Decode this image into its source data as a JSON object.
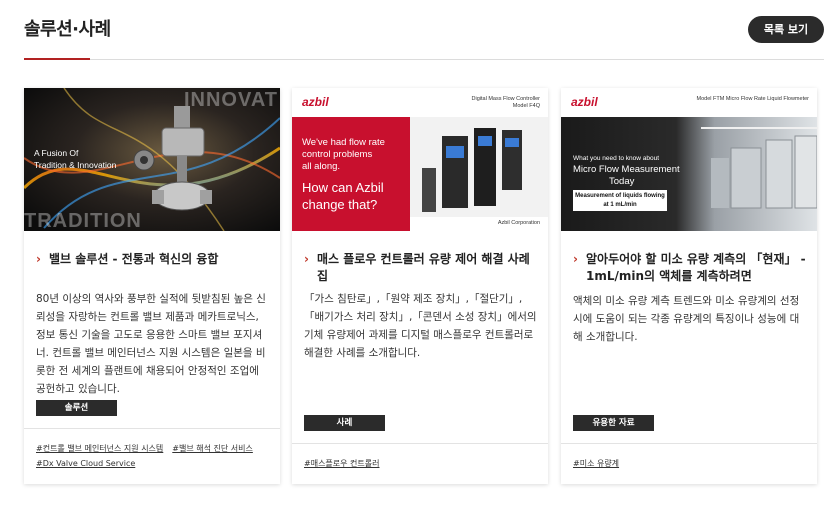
{
  "header": {
    "title": "솔루션·사례",
    "list_button": "목록 보기"
  },
  "cards": [
    {
      "image": {
        "overlay_line1": "A Fusion Of",
        "overlay_line2": "Tradition & Innovation",
        "word_top": "INNOVAT",
        "word_bottom": "TRADITION"
      },
      "title": "밸브 솔루션 - 전통과 혁신의 융합",
      "description": "80년 이상의 역사와 풍부한 실적에 뒷받침된 높은 신뢰성을 자랑하는 컨트롤 밸브 제품과 메카트로닉스, 정보 통신 기술을 고도로 응용한 스마트 밸브 포지셔너. 컨트롤 밸브 메인터넌스 지원 시스템은 일본을 비롯한 전 세계의 플랜트에 채용되어 안정적인 조업에 공헌하고 있습니다.",
      "badge": "솔루션",
      "tags": [
        "#컨트롤 밸브 메인터넌스 지원 시스템",
        "#밸브 해석 진단 서비스",
        "#Dx Valve Cloud Service"
      ]
    },
    {
      "image": {
        "logo": "azbil",
        "caption_line1": "Digital Mass Flow Controller",
        "caption_line2": "Model F4Q",
        "banner_line1": "We've had flow rate",
        "banner_line2": "control problems",
        "banner_line3": "all along.",
        "banner_question1": "How can Azbil",
        "banner_question2": "change that?",
        "footer": "Azbil Corporation"
      },
      "title": "매스 플로우 컨트롤러 유량 제어 해결 사례집",
      "description": "「가스 침탄로」,「원약 제조 장치」,「절단기」,「배기가스 처리 장치」,「콘덴서 소성 장치」에서의 기체 유량제어 과제를 디지털 매스플로우 컨트롤러로 해결한 사례를 소개합니다.",
      "badge": "사례",
      "tags": [
        "#매스플로우 컨트롤러"
      ]
    },
    {
      "image": {
        "logo": "azbil",
        "caption_line1": "Model FTM Micro Flow Rate Liquid Flowmeter",
        "headline1": "What you need to know about",
        "headline2": "Micro Flow Measurement",
        "headline3": "Today",
        "box_line1": "Measurement of liquids flowing",
        "box_line2": "at 1 mL/min"
      },
      "title": "알아두어야 할 미소 유량 계측의 「현재」 - 1mL/min의 액체를 계측하려면",
      "description": "액체의 미소 유량 계측 트렌드와 미소 유량계의 선정 시에 도움이 되는 각종 유량계의 특징이나 성능에 대해 소개합니다.",
      "badge": "유용한 자료",
      "tags": [
        "#미소 유량계"
      ]
    }
  ],
  "colors": {
    "accent": "#b22222",
    "badge_bg": "#2b2b2b",
    "azbil_red": "#c8102e"
  }
}
